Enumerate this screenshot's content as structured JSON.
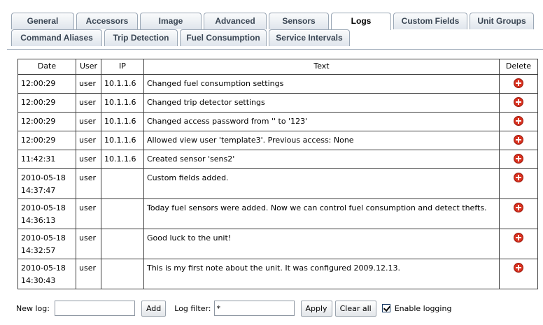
{
  "tabs_row1": [
    "General",
    "Accessors",
    "Image",
    "Advanced",
    "Sensors",
    "Logs",
    "Custom Fields",
    "Unit Groups"
  ],
  "tabs_row2": [
    "Command Aliases",
    "Trip Detection",
    "Fuel Consumption",
    "Service Intervals"
  ],
  "active_tab": "Logs",
  "table": {
    "headers": [
      "Date",
      "User",
      "IP",
      "Text",
      "Delete"
    ],
    "rows": [
      {
        "date1": "12:00:29",
        "date2": "",
        "user": "user",
        "ip": "10.1.1.6",
        "text": "Changed fuel consumption settings"
      },
      {
        "date1": "12:00:29",
        "date2": "",
        "user": "user",
        "ip": "10.1.1.6",
        "text": "Changed trip detector settings"
      },
      {
        "date1": "12:00:29",
        "date2": "",
        "user": "user",
        "ip": "10.1.1.6",
        "text": "Changed access password from '' to '123'"
      },
      {
        "date1": "12:00:29",
        "date2": "",
        "user": "user",
        "ip": "10.1.1.6",
        "text": "Allowed view user 'template3'. Previous access: None"
      },
      {
        "date1": "11:42:31",
        "date2": "",
        "user": "user",
        "ip": "10.1.1.6",
        "text": "Created sensor 'sens2'"
      },
      {
        "date1": "2010-05-18",
        "date2": "14:37:47",
        "user": "user",
        "ip": "",
        "text": "Custom fields added."
      },
      {
        "date1": "2010-05-18",
        "date2": "14:36:13",
        "user": "user",
        "ip": "",
        "text": "Today fuel sensors were added. Now we can control fuel consumption and detect thefts."
      },
      {
        "date1": "2010-05-18",
        "date2": "14:32:57",
        "user": "user",
        "ip": "",
        "text": "Good luck to the unit!"
      },
      {
        "date1": "2010-05-18",
        "date2": "14:30:43",
        "user": "user",
        "ip": "",
        "text": "This is my first note about the unit. It was configured 2009.12.13."
      }
    ]
  },
  "bottom": {
    "new_log_label": "New log:",
    "new_log_value": "",
    "add_label": "Add",
    "filter_label": "Log filter:",
    "filter_value": "*",
    "apply_label": "Apply",
    "clear_label": "Clear all",
    "enable_label": "Enable logging",
    "enable_checked": true
  },
  "icons": {
    "delete": "delete-icon"
  },
  "colors": {
    "tab_border": "#9aa7b5",
    "tab_text": "#3a4654",
    "delete_red": "#d8301e"
  }
}
